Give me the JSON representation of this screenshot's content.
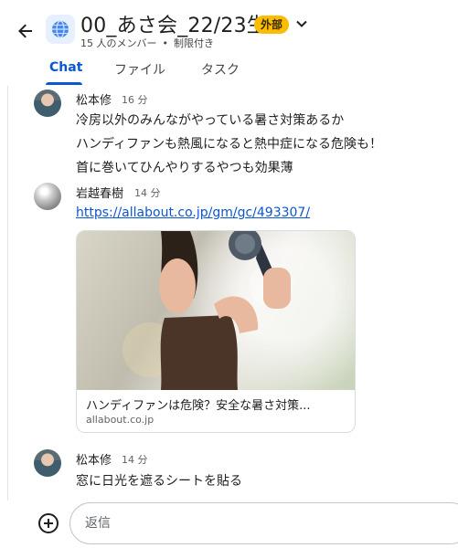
{
  "header": {
    "title": "00_あさ会_22/23生",
    "badge": "外部",
    "members": "15 人のメンバー",
    "restriction": "制限付き"
  },
  "tabs": [
    {
      "label": "Chat",
      "active": true
    },
    {
      "label": "ファイル",
      "active": false
    },
    {
      "label": "タスク",
      "active": false
    }
  ],
  "messages": [
    {
      "sender": "松本修",
      "time": "16 分",
      "lines": [
        "冷房以外のみんながやっている暑さ対策あるか",
        "ハンディファンも熱風になると熱中症になる危険も！",
        "首に巻いてひんやりするやつも効果薄"
      ]
    },
    {
      "sender": "岩越春樹",
      "time": "14 分",
      "link": "https://allabout.co.jp/gm/gc/493307/",
      "preview": {
        "title": "ハンディファンは危険？安全な暑さ対策...",
        "domain": "allabout.co.jp"
      }
    },
    {
      "sender": "松本修",
      "time": "14 分",
      "lines": [
        "窓に日光を遮るシートを貼る"
      ]
    }
  ],
  "composer": {
    "placeholder": "返信"
  },
  "colors": {
    "accent": "#0b57d0",
    "badge": "#fbbc04"
  }
}
